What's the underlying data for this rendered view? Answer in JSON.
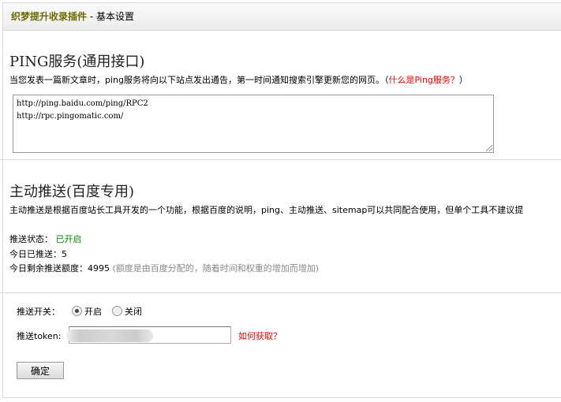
{
  "header": {
    "plugin_name": "织梦提升收录插件",
    "separator": " - ",
    "page": "基本设置"
  },
  "ping": {
    "title": "PING服务(通用接口)",
    "description": "当您发表一篇新文章时，ping服务将向以下站点发出通告，第一时间通知搜索引擎更新您的网页。（",
    "help_link": "什么是Ping服务？",
    "desc_end": "）",
    "urls": "http://ping.baidu.com/ping/RPC2\nhttp://rpc.pingomatic.com/"
  },
  "push": {
    "title": "主动推送(百度专用)",
    "description": "主动推送是根据百度站长工具开发的一个功能，根据百度的说明，ping、主动推送、sitemap可以共同配合使用，但单个工具不建议提",
    "status_label": "推送状态：",
    "status_value": "已开启",
    "today_label": "今日已推送：",
    "today_value": "5",
    "remain_label": "今日剩余推送额度：",
    "remain_value": "4995",
    "remain_note": "(额度是由百度分配的，随着时间和权重的增加而增加)"
  },
  "form": {
    "switch_label": "推送开关：",
    "on_label": "开启",
    "off_label": "关闭",
    "selected": "开启",
    "token_label": "推送token:",
    "token_help": "如何获取？",
    "submit": "确定"
  }
}
